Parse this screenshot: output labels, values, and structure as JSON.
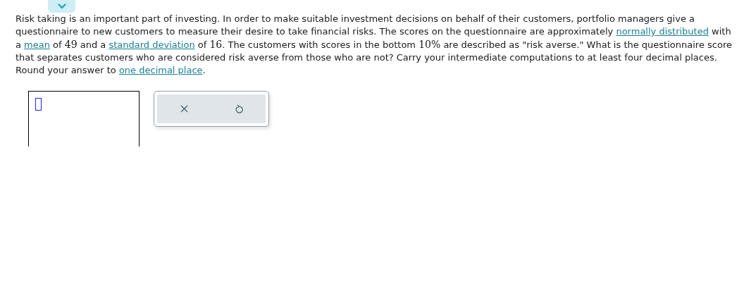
{
  "question": [
    {
      "kind": "text",
      "text": "Risk taking is an important part of investing. In order to make suitable investment decisions on behalf of their customers, portfolio managers give a questionnaire to new customers to measure their desire to take financial risks. The scores on the questionnaire are approximately "
    },
    {
      "kind": "link",
      "text": "normally distributed"
    },
    {
      "kind": "text",
      "text": " with a "
    },
    {
      "kind": "link",
      "text": "mean"
    },
    {
      "kind": "text",
      "text": " of "
    },
    {
      "kind": "math",
      "text": "49"
    },
    {
      "kind": "text",
      "text": " and a "
    },
    {
      "kind": "link",
      "text": "standard deviation"
    },
    {
      "kind": "text",
      "text": " of "
    },
    {
      "kind": "math",
      "text": "16"
    },
    {
      "kind": "text",
      "text": ". The customers with scores in the bottom "
    },
    {
      "kind": "math",
      "text": "10%"
    },
    {
      "kind": "text",
      "text": " are described as \"risk averse.\" What is the questionnaire score that separates customers who are considered risk averse from those who are not? Carry your intermediate computations to at least four decimal places. Round your answer to "
    },
    {
      "kind": "link",
      "text": "one decimal place"
    },
    {
      "kind": "text",
      "text": "."
    }
  ]
}
